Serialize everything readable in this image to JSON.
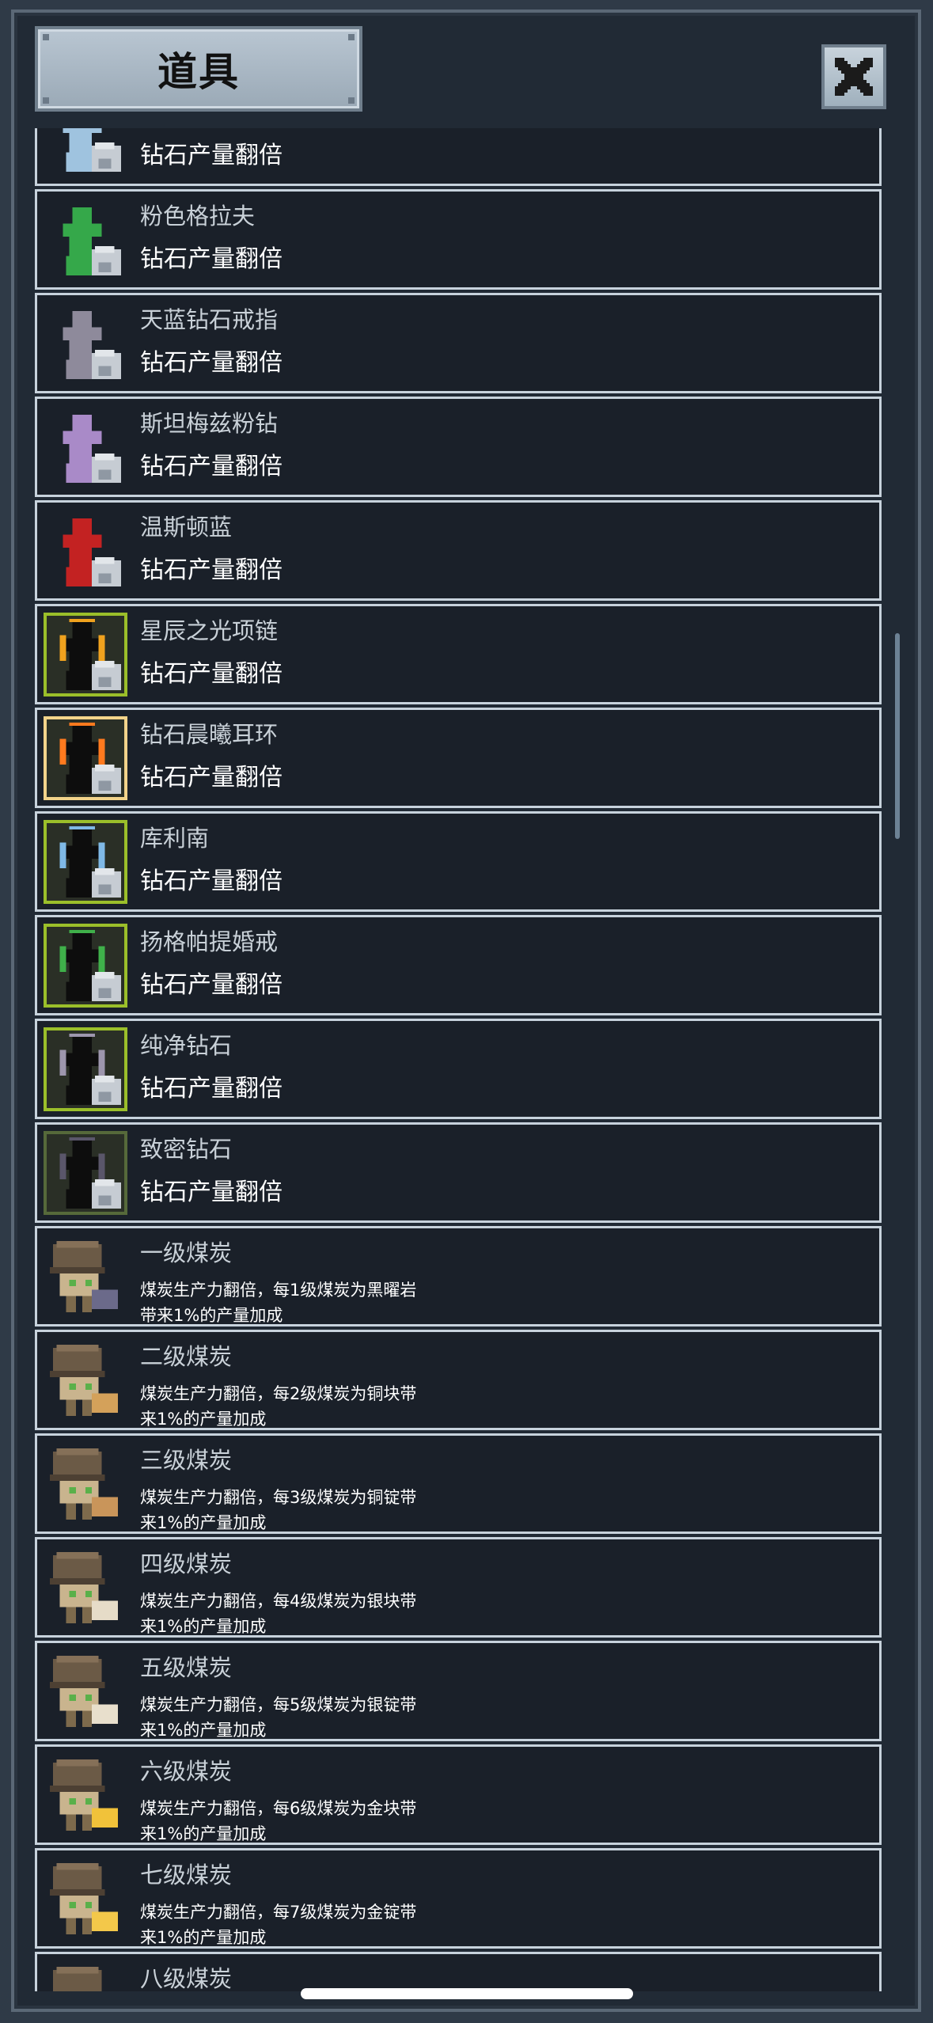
{
  "header": {
    "title": "道具"
  },
  "items": [
    {
      "name": "",
      "desc": "钻石产量翻倍",
      "icon": "diamond-statue-icon",
      "color": "#9fc3df"
    },
    {
      "name": "粉色格拉夫",
      "desc": "钻石产量翻倍",
      "icon": "diamond-statue-icon",
      "color": "#35a84a"
    },
    {
      "name": "天蓝钻石戒指",
      "desc": "钻石产量翻倍",
      "icon": "diamond-statue-icon",
      "color": "#8e8a9b"
    },
    {
      "name": "斯坦梅兹粉钻",
      "desc": "钻石产量翻倍",
      "icon": "diamond-statue-icon",
      "color": "#a98ac8"
    },
    {
      "name": "温斯顿蓝",
      "desc": "钻石产量翻倍",
      "icon": "diamond-statue-icon",
      "color": "#c32222"
    },
    {
      "name": "星辰之光项链",
      "desc": "钻石产量翻倍",
      "icon": "diamond-silhouette-icon",
      "color": "#f0a21e",
      "frame": "#9bbf2a"
    },
    {
      "name": "钻石晨曦耳环",
      "desc": "钻石产量翻倍",
      "icon": "diamond-silhouette-icon",
      "color": "#ff7a1e",
      "frame": "#f2d38a"
    },
    {
      "name": "库利南",
      "desc": "钻石产量翻倍",
      "icon": "diamond-silhouette-icon",
      "color": "#7fb9e6",
      "frame": "#9bbf2a"
    },
    {
      "name": "扬格帕提婚戒",
      "desc": "钻石产量翻倍",
      "icon": "diamond-silhouette-icon",
      "color": "#3fb04a",
      "frame": "#9bbf2a"
    },
    {
      "name": "纯净钻石",
      "desc": "钻石产量翻倍",
      "icon": "diamond-silhouette-icon",
      "color": "#9d96ad",
      "frame": "#9bbf2a"
    },
    {
      "name": "致密钻石",
      "desc": "钻石产量翻倍",
      "icon": "diamond-silhouette-icon",
      "color": "#5a566a",
      "frame": "#56693a"
    },
    {
      "name": "一级煤炭",
      "desc": "煤炭生产力翻倍，每1级煤炭为黑曜岩带来1%的产量加成",
      "icon": "miner-obsidian-icon",
      "color": "#6b6a8a"
    },
    {
      "name": "二级煤炭",
      "desc": "煤炭生产力翻倍，每2级煤炭为铜块带来1%的产量加成",
      "icon": "miner-copper-nugget-icon",
      "color": "#d4a15a"
    },
    {
      "name": "三级煤炭",
      "desc": "煤炭生产力翻倍，每3级煤炭为铜锭带来1%的产量加成",
      "icon": "miner-copper-ingot-icon",
      "color": "#c9955a"
    },
    {
      "name": "四级煤炭",
      "desc": "煤炭生产力翻倍，每4级煤炭为银块带来1%的产量加成",
      "icon": "miner-silver-nugget-icon",
      "color": "#e6dcc8"
    },
    {
      "name": "五级煤炭",
      "desc": "煤炭生产力翻倍，每5级煤炭为银锭带来1%的产量加成",
      "icon": "miner-silver-ingot-icon",
      "color": "#e8dfcc"
    },
    {
      "name": "六级煤炭",
      "desc": "煤炭生产力翻倍，每6级煤炭为金块带来1%的产量加成",
      "icon": "miner-gold-nugget-icon",
      "color": "#f1c23a"
    },
    {
      "name": "七级煤炭",
      "desc": "煤炭生产力翻倍，每7级煤炭为金锭带来1%的产量加成",
      "icon": "miner-gold-ingot-icon",
      "color": "#f3c84a"
    },
    {
      "name": "八级煤炭",
      "desc": "",
      "icon": "miner-icon",
      "color": "#7a6a55"
    }
  ]
}
